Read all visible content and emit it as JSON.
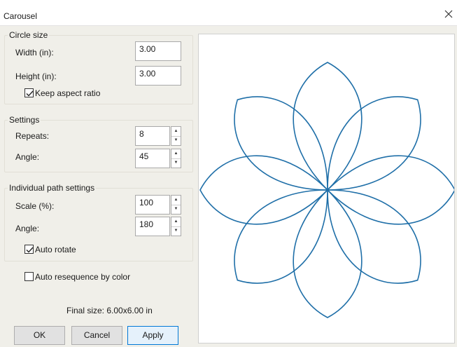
{
  "window": {
    "title": "Carousel"
  },
  "circle_size": {
    "legend": "Circle size",
    "width_label": "Width (in):",
    "width_value": "3.00",
    "height_label": "Height (in):",
    "height_value": "3.00",
    "keep_aspect_label": "Keep aspect ratio",
    "keep_aspect_checked": true
  },
  "settings": {
    "legend": "Settings",
    "repeats_label": "Repeats:",
    "repeats_value": "8",
    "angle_label": "Angle:",
    "angle_value": "45"
  },
  "individual": {
    "legend": "Individual path settings",
    "scale_label": "Scale (%):",
    "scale_value": "100",
    "angle_label": "Angle:",
    "angle_value": "180",
    "auto_rotate_label": "Auto rotate",
    "auto_rotate_checked": true
  },
  "auto_resequence": {
    "label": "Auto resequence by color",
    "checked": false
  },
  "final_size": "Final size: 6.00x6.00 in",
  "buttons": {
    "ok": "OK",
    "cancel": "Cancel",
    "apply": "Apply"
  },
  "preview": {
    "stroke_color": "#1f6fa8",
    "petals": 8
  },
  "icons": {
    "close": "close-icon",
    "check": "checkmark-icon",
    "spin_up": "spin-up-icon",
    "spin_down": "spin-down-icon"
  }
}
